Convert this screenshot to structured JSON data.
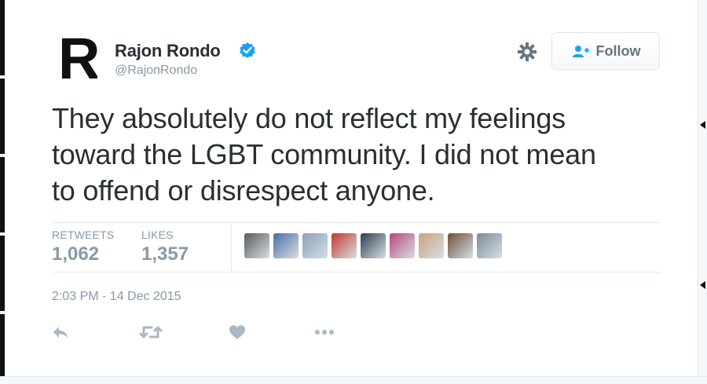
{
  "author": {
    "name": "Rajon Rondo",
    "handle": "@RajonRondo",
    "avatar_letter": "R",
    "verified": true
  },
  "follow_button": {
    "label": "Follow",
    "icon": "add-user-icon"
  },
  "settings": {
    "icon": "gear-icon"
  },
  "tweet": {
    "lines": [
      "They absolutely do not reflect my feelings",
      "toward the LGBT community. I did not mean",
      "to offend or disrespect anyone."
    ]
  },
  "stats": {
    "retweets_label": "RETWEETS",
    "retweets_value": "1,062",
    "likes_label": "LIKES",
    "likes_value": "1,357"
  },
  "likers": [
    {
      "name": "liker-1",
      "color": "#5a5a5a"
    },
    {
      "name": "liker-2",
      "color": "#4a6fa5"
    },
    {
      "name": "liker-3",
      "color": "#8aa0b8"
    },
    {
      "name": "liker-4",
      "color": "#c0392b"
    },
    {
      "name": "liker-5",
      "color": "#2c3e50"
    },
    {
      "name": "liker-6",
      "color": "#b5487a"
    },
    {
      "name": "liker-7",
      "color": "#c9a27e"
    },
    {
      "name": "liker-8",
      "color": "#6b4f3a"
    },
    {
      "name": "liker-9",
      "color": "#7a8c99"
    }
  ],
  "timestamp": "2:03 PM - 14 Dec 2015",
  "actions": [
    {
      "name": "reply-icon"
    },
    {
      "name": "retweet-icon"
    },
    {
      "name": "like-icon"
    },
    {
      "name": "more-icon"
    }
  ],
  "colors": {
    "text": "#292f33",
    "muted": "#8899a6",
    "accent": "#1da1f2",
    "border": "#e1e8ed"
  }
}
